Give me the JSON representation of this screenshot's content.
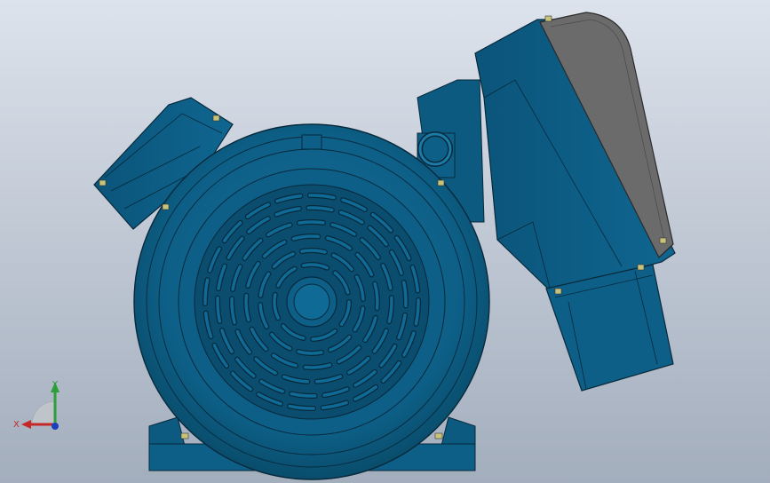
{
  "viewport": {
    "background_top": "#dde3ec",
    "background_bottom": "#a3aebd"
  },
  "model": {
    "body_color": "#0d5f87",
    "body_dark": "#094866",
    "body_light": "#1f77a3",
    "cover_color": "#6b6b6b",
    "edge_color": "#07293b",
    "bolt_color": "#c8c27a"
  },
  "triad": {
    "x_label": "X",
    "y_label": "Y",
    "x_color": "#c62828",
    "y_color": "#2e9e3a",
    "z_color": "#1a3fbf"
  }
}
